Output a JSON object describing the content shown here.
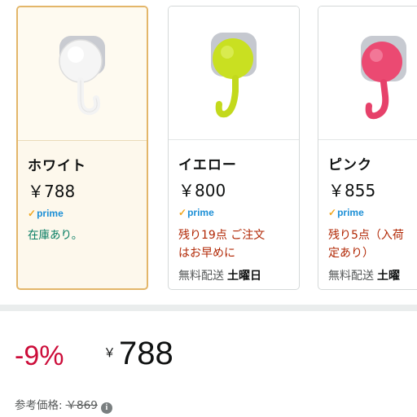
{
  "variants": [
    {
      "name": "ホワイト",
      "price": "￥788",
      "prime_label": "prime",
      "stock": "在庫あり。",
      "color": "#f2f2f2",
      "icon": "white-suction-hook-image",
      "selected": true
    },
    {
      "name": "イエロー",
      "price": "￥800",
      "prime_label": "prime",
      "stock_line1": "残り19点 ご注文",
      "stock_line2": "はお早めに",
      "delivery": "無料配送",
      "delivery_day": "土曜日",
      "color": "#c7de1c",
      "icon": "yellow-suction-hook-image"
    },
    {
      "name": "ピンク",
      "price": "￥855",
      "prime_label": "prime",
      "stock_line1": "残り5点（入荷",
      "stock_line2": "定あり）",
      "delivery": "無料配送",
      "delivery_day": "土曜",
      "color": "#e8436f",
      "icon": "pink-suction-hook-image"
    }
  ],
  "price_block": {
    "discount": "-9%",
    "currency": "￥",
    "price": "788",
    "reference_label": "参考価格:",
    "reference_price": "￥869",
    "info_icon": "info-icon"
  },
  "colors": {
    "discount_red": "#cc0c39",
    "stock_green": "#067d62",
    "low_stock_red": "#b12704",
    "prime_blue": "#1c8fd6",
    "selected_border": "#e3b66a"
  }
}
